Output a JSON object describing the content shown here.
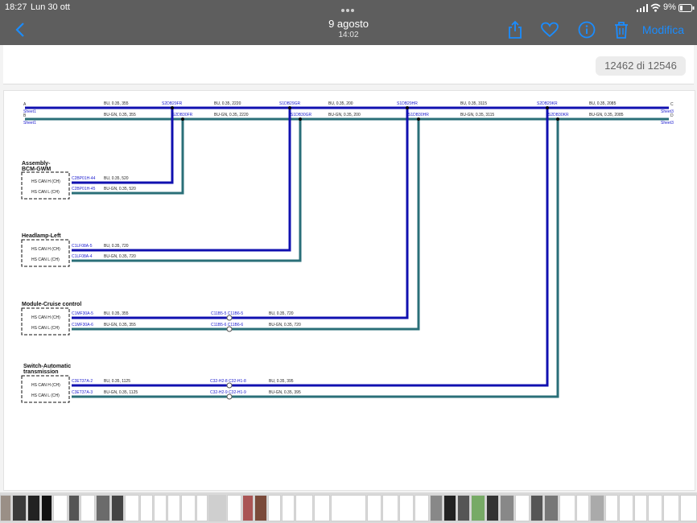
{
  "status": {
    "time": "18:27",
    "date": "Lun 30 ott",
    "battery": "9%"
  },
  "header": {
    "title": "9 agosto",
    "subtitle": "14:02",
    "edit_label": "Modifica"
  },
  "icons": {
    "back": "chevron-left-icon",
    "share": "share-icon",
    "favorite": "heart-icon",
    "info": "info-icon",
    "delete": "trash-icon"
  },
  "counter": "12462 di 12546",
  "colors": {
    "bu": "#1010b0",
    "bugn": "#2a6f78",
    "label_blue": "#2020d0",
    "accent": "#1a8cff"
  },
  "diagram": {
    "sheet_left": "Sheet1",
    "sheet_right": "Sheet3",
    "conn_a": "A",
    "conn_b": "B",
    "conn_c": "C",
    "conn_d": "D",
    "top_segments": [
      {
        "bu": "BU, 0.35, 355",
        "bugn": "BU-GN, 0.35, 355"
      },
      {
        "bu": "BU, 0.35, 2220",
        "bugn": "BU-GN, 0.35, 2220"
      },
      {
        "bu": "BU, 0.35, 200",
        "bugn": "BU-GN, 0.35, 200"
      },
      {
        "bu": "BU, 0.35, 3115",
        "bugn": "BU-GN, 0.35, 3115"
      },
      {
        "bu": "BU, 0.35, 2085",
        "bugn": "BU-GN, 0.35, 2085"
      }
    ],
    "splices": [
      {
        "top": "S2DB29FR",
        "bottom": "S2DB30FR"
      },
      {
        "top": "S1DB29GR",
        "bottom": "S1DB30GR"
      },
      {
        "top": "S1DB29HR",
        "bottom": "S1DB30HR"
      },
      {
        "top": "S2DB29KR",
        "bottom": "S2DB30KR"
      }
    ],
    "modules": [
      {
        "name1": "Assembly-",
        "name2": "BCM-GWM",
        "pin_h": "HS CAN H (CH)",
        "pin_l": "HS CAN L (CH)",
        "conn_h": "C2BP01H-44",
        "conn_l": "C2BP01H-45",
        "wire_h": "BU, 0.35, 520",
        "wire_l": "BU-GN, 0.35, 520"
      },
      {
        "name1": "Headlamp-Left",
        "name2": "",
        "pin_h": "HS CAN H (CH)",
        "pin_l": "HS CAN L (CH)",
        "conn_h": "C1LF08A-5",
        "conn_l": "C1LF08A-4",
        "wire_h": "BU, 0.35, 720",
        "wire_l": "BU-GN, 0.35, 720"
      },
      {
        "name1": "Module-Cruise control",
        "name2": "",
        "pin_h": "HS CAN H (CH)",
        "pin_l": "HS CAN L (CH)",
        "conn_h": "C1MF30A-5",
        "conn_l": "C1MF30A-6",
        "wire_h": "BU, 0.35, 355",
        "wire_l": "BU-GN, 0.35, 355",
        "inline_h": "C11B5-5  C11B6-5",
        "inline_l": "C11B5-6  C11B6-6",
        "wire_h2": "BU, 0.35, 720",
        "wire_l2": "BU-GN, 0.35, 720"
      },
      {
        "name1": "Switch-Automatic",
        "name2": "transmission",
        "pin_h": "HS CAN H (CH)",
        "pin_l": "HS CAN L (CH)",
        "conn_h": "C3ET37A-2",
        "conn_l": "C3ET37A-3",
        "wire_h": "BU, 0.35, 1125",
        "wire_l": "BU-GN, 0.35, 1125",
        "inline_h": "C32-H2-8  C32-H1-8",
        "inline_l": "C32-H2-9  C32-H1-9",
        "wire_h2": "BU, 0.35, 395",
        "wire_l2": "BU-GN, 0.35, 395"
      }
    ]
  }
}
